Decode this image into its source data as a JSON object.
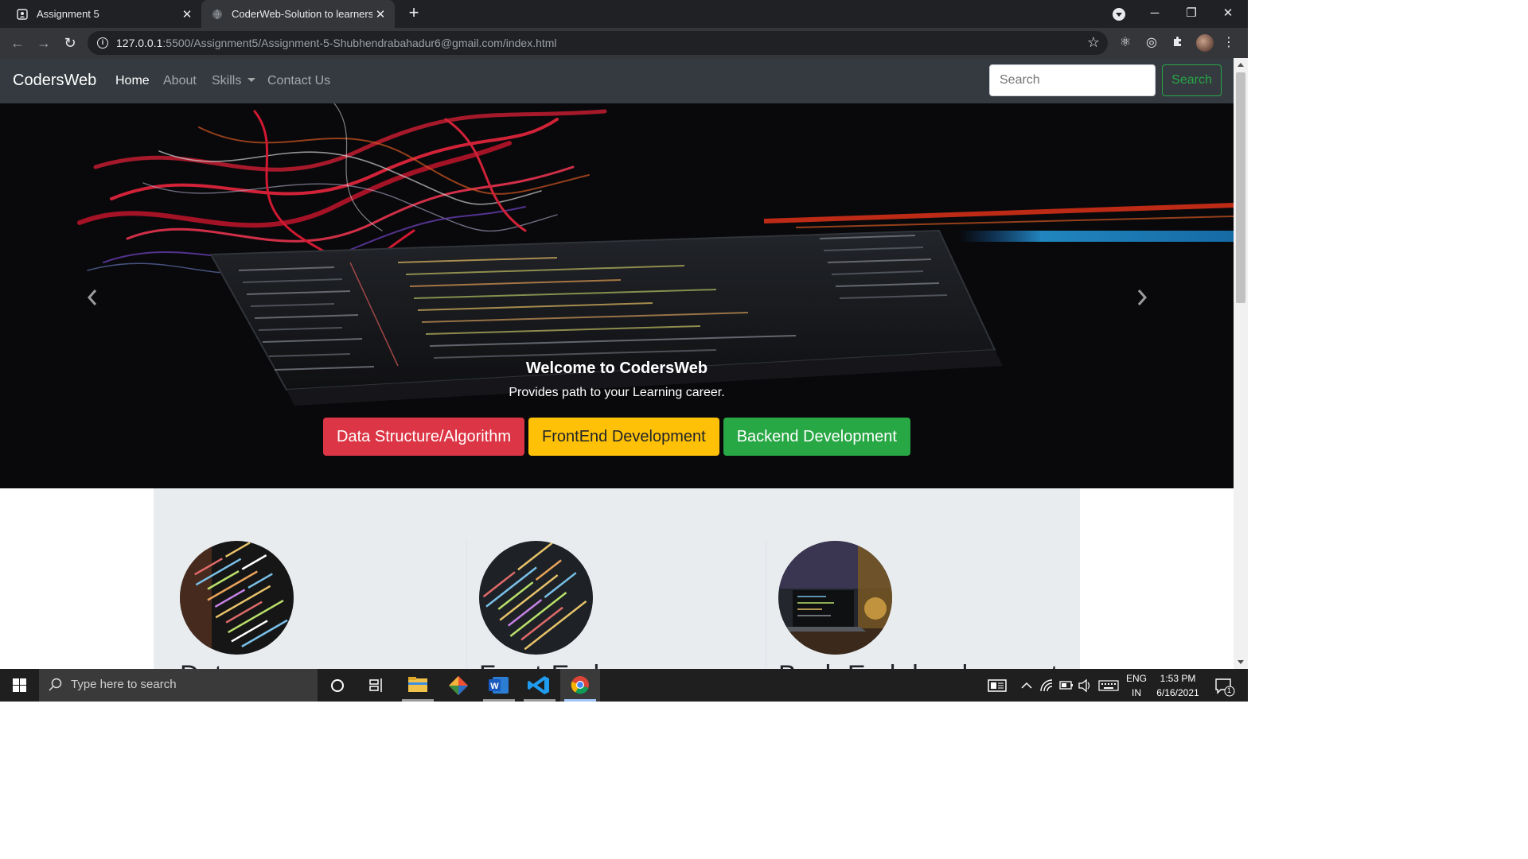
{
  "browser": {
    "tabs": [
      {
        "title": "Assignment 5",
        "active": false
      },
      {
        "title": "CoderWeb-Solution to learners",
        "active": true
      }
    ],
    "url_host": "127.0.0.1",
    "url_rest": ":5500/Assignment5/Assignment-5-Shubhendrabahadur6@gmail.com/index.html"
  },
  "navbar": {
    "brand": "CodersWeb",
    "links": [
      {
        "label": "Home",
        "active": true
      },
      {
        "label": "About",
        "active": false
      },
      {
        "label": "Skills",
        "active": false,
        "dropdown": true
      },
      {
        "label": "Contact Us",
        "active": false
      }
    ],
    "search_placeholder": "Search",
    "search_button": "Search"
  },
  "carousel": {
    "title": "Welcome to CodersWeb",
    "subtitle": "Provides path to your Learning career.",
    "buttons": [
      {
        "label": "Data Structure/Algorithm",
        "color": "#dc3545"
      },
      {
        "label": "FrontEnd Development",
        "color": "#ffc107"
      },
      {
        "label": "Backend Development",
        "color": "#28a745"
      }
    ]
  },
  "marketing": {
    "columns": [
      {
        "heading": "Data"
      },
      {
        "heading": "Front-End"
      },
      {
        "heading": "Back-End development"
      }
    ]
  },
  "taskbar": {
    "search_placeholder": "Type here to search",
    "lang_top": "ENG",
    "lang_bottom": "IN",
    "time": "1:53 PM",
    "date": "6/16/2021",
    "notification_count": "1"
  }
}
